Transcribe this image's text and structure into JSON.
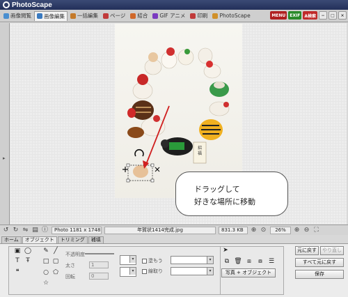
{
  "app": {
    "title": "PhotoScape"
  },
  "tabs": [
    {
      "label": "画像閲覧",
      "color": "#4a8fd0"
    },
    {
      "label": "画像編集",
      "color": "#3a7ac0",
      "active": true
    },
    {
      "label": "一括編集",
      "color": "#c47a2a"
    },
    {
      "label": "ページ",
      "color": "#c03a3a"
    },
    {
      "label": "結合",
      "color": "#d0682a"
    },
    {
      "label": "GIF アニメ",
      "color": "#7a3ac0"
    },
    {
      "label": "印刷",
      "color": "#c03a3a"
    },
    {
      "label": "PhotoScape",
      "color": "#d0902a"
    }
  ],
  "top_buttons": {
    "menu": "MENU",
    "exif": "EXIF",
    "search": "A検索"
  },
  "callout": {
    "line1": "ドラッグして",
    "line2": "好きな場所に移動"
  },
  "status": {
    "photo_size": "Photo 1181 x 1748",
    "filename": "年賀状1414完成.jpg",
    "file_size": "831.3 KB",
    "zoom": "26%"
  },
  "panel_tabs": [
    "ホーム",
    "オブジェクト",
    "トリミング",
    "補填"
  ],
  "panel": {
    "opacity_label": "不透明度",
    "thickness_label": "太さ",
    "rotate_label": "回転",
    "rotate_value": "0",
    "thickness_value": "1",
    "fill_label": "塗もう",
    "outline_label": "線取り",
    "photo_object_button": "写真 + オブジェクト",
    "undo_button": "元に戻す",
    "redo_button": "やり直し",
    "undo_all_button": "すべて元に戻す",
    "save_button": "保存"
  },
  "colors": {
    "title_bar": "#2a3662",
    "red_arrow": "#d02020"
  }
}
